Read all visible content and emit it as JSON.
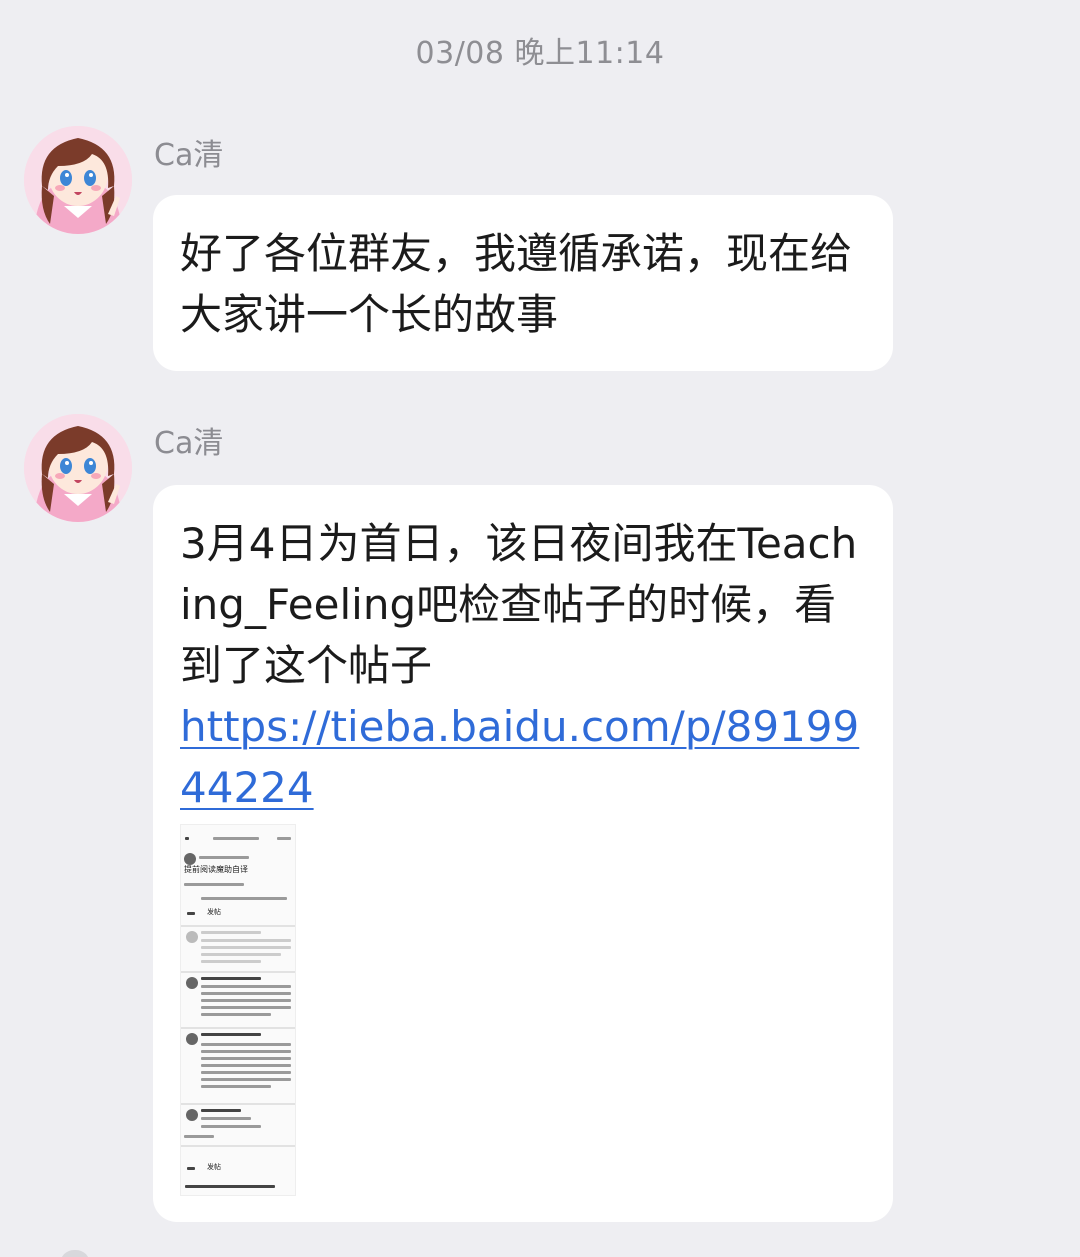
{
  "timestamp": "03/08 晚上11:14",
  "messages": [
    {
      "sender": "Ca清",
      "text": "好了各位群友，我遵循承诺，现在给大家讲一个长的故事"
    },
    {
      "sender": "Ca清",
      "text": "3月4日为首日，该日夜间我在Teaching_Feeling吧检查帖子的时候，看到了这个帖子",
      "link": "https://tieba.baidu.com/p/8919944224",
      "attachment": {
        "type": "screenshot-thumbnail",
        "post_title": "提前阅读魔助自译",
        "section_header": "发帖",
        "bottom_header": "发帖"
      }
    }
  ]
}
